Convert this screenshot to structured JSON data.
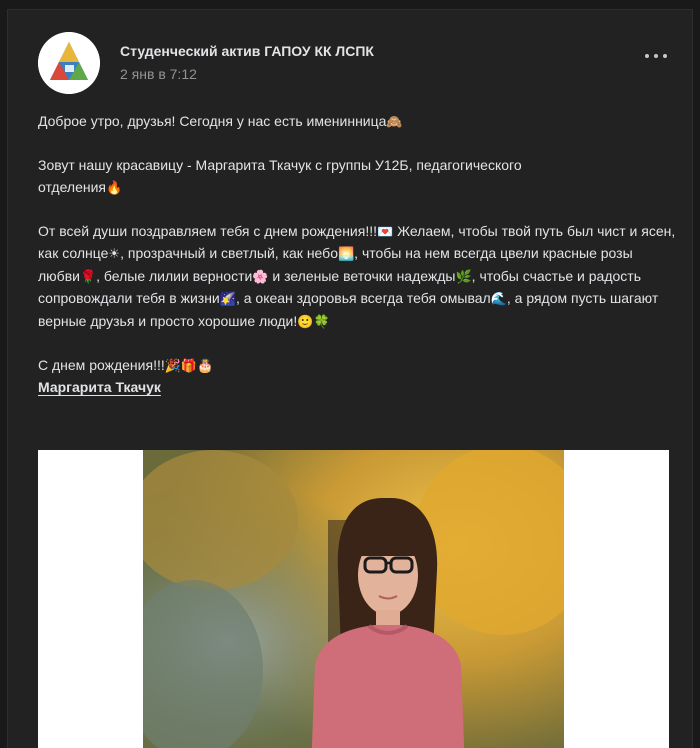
{
  "post": {
    "author": "Студенческий актив ГАПОУ КК ЛСПК",
    "timestamp": "2 янв в 7:12",
    "avatar_icon": "triangle-logo-icon",
    "menu_icon": "more-horizontal-icon",
    "text": {
      "line1": "Доброе утро, друзья! Сегодня у нас есть именинница",
      "line1_emoji": "🙈",
      "line2": "Зовут нашу красавицу - Маргарита Ткачук с группы У12Б, педагогического",
      "line3": "отделения",
      "line3_emoji": "🔥",
      "p3_a": "От всей души поздравляем тебя с днем рождения!!!",
      "p3_emoji_letter": "💌",
      "p3_b": " Желаем, чтобы твой путь был чист и ясен, как солнце",
      "p3_emoji_sun": "☀",
      "p3_c": ", прозрачный и светлый, как небо",
      "p3_emoji_sky": "🌅",
      "p3_d": ", чтобы на нем всегда цвели красные розы любви",
      "p3_emoji_rose": "🌹",
      "p3_e": ", белые лилии верности",
      "p3_emoji_flower": "🌸",
      "p3_f": " и зеленые веточки надежды",
      "p3_emoji_herb": "🌿",
      "p3_g": ", чтобы счастье и радость сопровождали тебя в жизни",
      "p3_emoji_star": "🌠",
      "p3_h": ", а океан здоровья всегда тебя омывал",
      "p3_emoji_wave": "🌊",
      "p3_i": ", а рядом пусть шагают верные друзья и просто хорошие люди!",
      "p3_emoji_smile": "🙂",
      "p3_emoji_clover": "🍀",
      "congrats": "С днем рождения!!!",
      "congrats_emoji": "🎉🎁🎂",
      "mention": "Маргарита Ткачук"
    }
  },
  "colors": {
    "background": "#191919",
    "card": "#222222",
    "text": "#e1e3e6",
    "secondary_text": "#939393"
  }
}
